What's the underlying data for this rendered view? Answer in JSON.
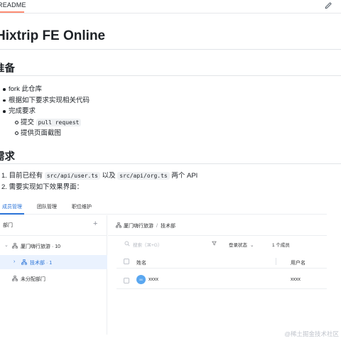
{
  "readme_tab": "README",
  "icons": {
    "edit": "pencil-icon",
    "org": "org-tree-icon",
    "search": "search-icon",
    "filter": "filter-icon",
    "plus": "plus-icon"
  },
  "title": "Hixtrip FE Online",
  "section_prepare": "准备",
  "prepare_items": [
    "fork 此仓库",
    "根据如下要求实现相关代码",
    "完成要求"
  ],
  "prepare_subitems": [
    {
      "text": "提交",
      "code": "pull request"
    },
    {
      "text": "提供页面截图"
    }
  ],
  "section_requirements": "需求",
  "requirements": [
    {
      "num": "1.",
      "pre": "目前已经有",
      "code1": "src/api/user.ts",
      "mid": "以及",
      "code2": "src/api/org.ts",
      "post": "两个 API"
    },
    {
      "num": "2.",
      "text": "需要实现如下效果界面："
    }
  ],
  "demo": {
    "tabs": [
      "成员管理",
      "团队管理",
      "职位维护"
    ],
    "dept_header": "部门",
    "plus": "+",
    "tree": [
      {
        "caret": "⌄",
        "label": "厦门嗨行旅游 · 10"
      },
      {
        "caret": "›",
        "label": "技术部 · 1"
      },
      {
        "label": "未分配部门"
      }
    ],
    "breadcrumb": {
      "root": "厦门嗨行旅游",
      "sep": "/",
      "current": "技术部"
    },
    "search_placeholder": "搜索（⌘+G）",
    "status_select": "登录状态",
    "status_chevron": "⌄",
    "member_count": "1 个成员",
    "columns": [
      "姓名",
      "用户名"
    ],
    "rows": [
      {
        "avatar": "xx",
        "name": "xxxx",
        "username": "xxxx"
      }
    ]
  },
  "watermark": "@稀土掘金技术社区",
  "colors": {
    "accent": "#2b74d8",
    "selected_bg": "#eaf2fe",
    "avatar": "#5aa7f0",
    "tab_underline": "#fd8c73"
  }
}
